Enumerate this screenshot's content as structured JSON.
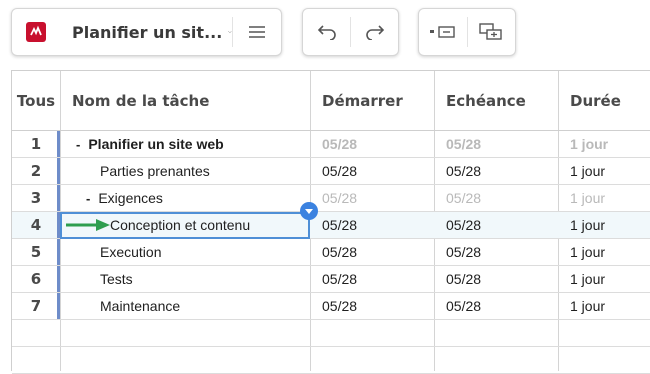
{
  "toolbar": {
    "app_icon": "smartsheet-logo-icon",
    "sheet_name": "Planifier un sit...",
    "icons": [
      "chevron-down-icon",
      "menu-icon",
      "undo-icon",
      "redo-icon",
      "outdent-icon",
      "indent-icon"
    ]
  },
  "columns": [
    "Tous",
    "Nom de la tâche",
    "Démarrer",
    "Echéance",
    "Durée"
  ],
  "rows": [
    {
      "num": "1",
      "task": "Planifier un site web",
      "start": "05/28",
      "end": "05/28",
      "duration": "1 jour"
    },
    {
      "num": "2",
      "task": "Parties prenantes",
      "start": "05/28",
      "end": "05/28",
      "duration": "1 jour"
    },
    {
      "num": "3",
      "task": "Exigences",
      "start": "05/28",
      "end": "05/28",
      "duration": "1 jour"
    },
    {
      "num": "4",
      "task": "Conception et contenu",
      "start": "05/28",
      "end": "05/28",
      "duration": "1 jour"
    },
    {
      "num": "5",
      "task": "Execution",
      "start": "05/28",
      "end": "05/28",
      "duration": "1 jour"
    },
    {
      "num": "6",
      "task": "Tests",
      "start": "05/28",
      "end": "05/28",
      "duration": "1 jour"
    },
    {
      "num": "7",
      "task": "Maintenance",
      "start": "05/28",
      "end": "05/28",
      "duration": "1 jour"
    }
  ],
  "colors": {
    "accent": "#c8102e",
    "selection": "#4f8fd6",
    "arrow": "#2e9e4f",
    "row_bar": "#6e8cc9"
  }
}
